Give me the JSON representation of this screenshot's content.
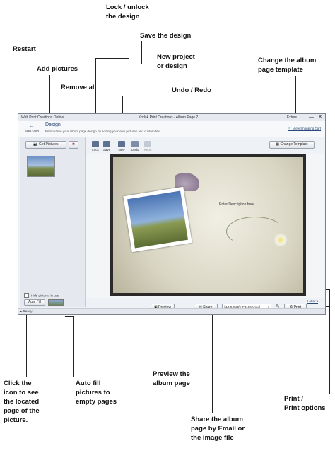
{
  "annotations": {
    "lock": [
      "Lock / unlock",
      "the design"
    ],
    "save": "Save the design",
    "restart": "Restart",
    "new_project": [
      "New project",
      "or design"
    ],
    "change_template": [
      "Change the album",
      "page template"
    ],
    "add_pictures": "Add pictures",
    "remove_all": "Remove all",
    "undo_redo": "Undo / Redo",
    "click_icon": [
      "Click the",
      "icon to see",
      "the located",
      "page of the",
      "picture."
    ],
    "auto_fill": [
      "Auto fill",
      "pictures to",
      "empty pages"
    ],
    "preview": [
      "Preview the",
      "album page"
    ],
    "share": [
      "Share the album",
      "page by  Email or",
      "the image file"
    ],
    "print": [
      "Print /",
      "Print options"
    ]
  },
  "window": {
    "app_title": "Walt Print Creations Online",
    "center_title": "Kodak Print Creations - Album Page 2",
    "extras": "Extras",
    "minimize": "—",
    "close": "✕"
  },
  "header": {
    "start_over": "Start Over",
    "design_title": "Design",
    "design_subtitle": "Personalize your album page design by adding your own pictures and custom text.",
    "cart": "View Shopping Cart"
  },
  "toolbar": {
    "get_pictures": "Get Pictures",
    "lock": "Lock",
    "save": "Save",
    "new": "New",
    "undo": "Undo",
    "redo": "Redo",
    "change_template": "Change Template"
  },
  "page": {
    "description_placeholder": "Enter Description here."
  },
  "left_panel": {
    "hide_pictures": "Hide pictures in use",
    "auto_fill": "Auto-Fill"
  },
  "bottom": {
    "letter": "Letter",
    "preview": "Preview",
    "share": "Share",
    "printer": "\\\\10.0.0.25\\HP4100-Used",
    "print": "Print",
    "status": "Ready"
  },
  "colors": {
    "accent": "#2c4a78",
    "frame": "#2b2a28"
  }
}
